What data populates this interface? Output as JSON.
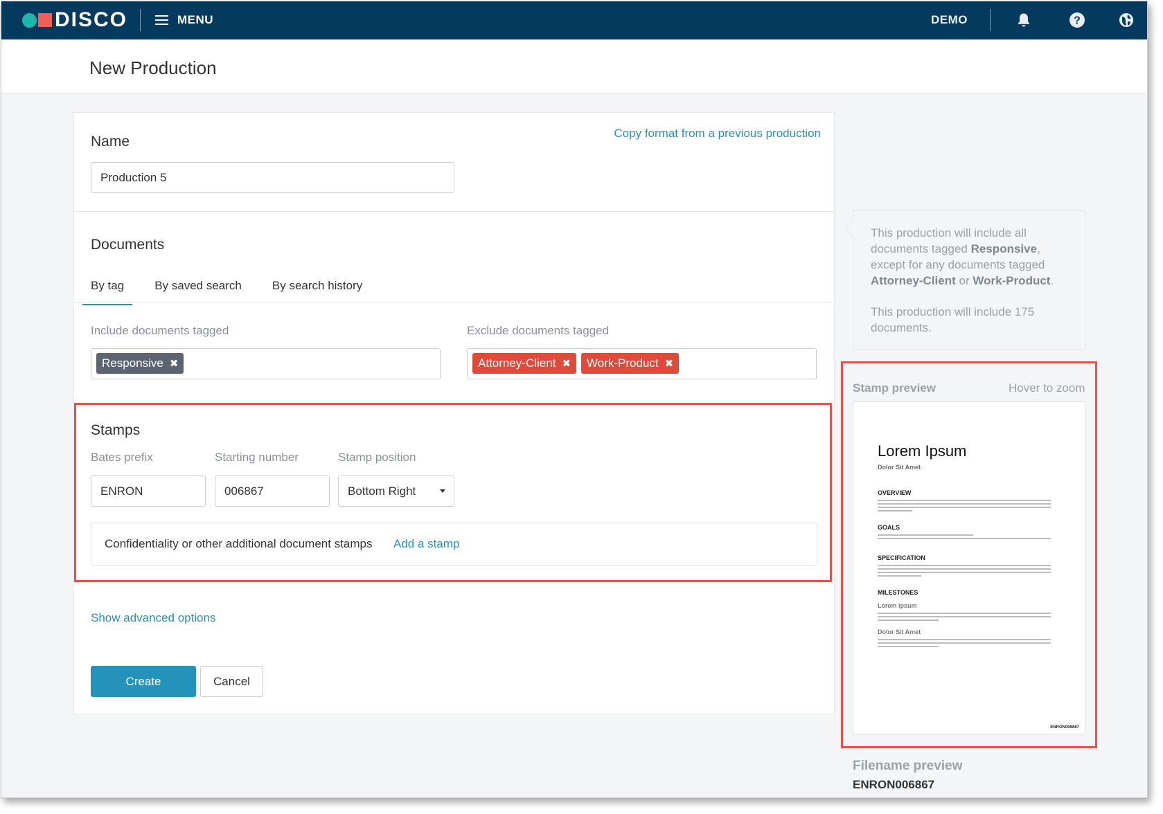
{
  "app": {
    "logo_text": "DISCO",
    "menu_label": "MENU",
    "user_label": "DEMO",
    "icons": [
      "bell-icon",
      "help-icon",
      "globe-icon",
      "hamburger-icon"
    ]
  },
  "page": {
    "title": "New Production"
  },
  "name_section": {
    "heading": "Name",
    "copy_link": "Copy format from a previous production",
    "name_value": "Production 5"
  },
  "documents": {
    "heading": "Documents",
    "tabs": [
      {
        "label": "By tag",
        "active": true
      },
      {
        "label": "By saved search",
        "active": false
      },
      {
        "label": "By search history",
        "active": false
      }
    ],
    "include_label": "Include documents tagged",
    "include_tags": [
      "Responsive"
    ],
    "exclude_label": "Exclude documents tagged",
    "exclude_tags": [
      "Attorney-Client",
      "Work-Product"
    ]
  },
  "stamps": {
    "heading": "Stamps",
    "bates_prefix_label": "Bates prefix",
    "bates_prefix_value": "ENRON",
    "starting_number_label": "Starting number",
    "starting_number_value": "006867",
    "position_label": "Stamp position",
    "position_value": "Bottom Right",
    "additional_text": "Confidentiality or other additional document stamps",
    "add_stamp_link": "Add a stamp"
  },
  "advanced_link": "Show advanced options",
  "actions": {
    "create": "Create",
    "cancel": "Cancel"
  },
  "summary": {
    "line1_a": "This production will include all documents tagged",
    "tag_include": "Responsive",
    "line1_b": ", except for any documents tagged",
    "tag_ex1": "Attorney-Client",
    "or_word": "or",
    "tag_ex2": "Work-Product",
    "line1_end": ".",
    "line2": "This production will include 175 documents."
  },
  "stamp_preview": {
    "label": "Stamp preview",
    "hint": "Hover to zoom",
    "doc_title": "Lorem Ipsum",
    "doc_subtitle": "Dolor Sit Amet",
    "h_overview": "OVERVIEW",
    "h_goals": "GOALS",
    "h_spec": "SPECIFICATION",
    "h_milestones": "MILESTONES",
    "sub_lorem": "Lorem ipsum",
    "sub_dolor": "Dolor Sit Amet",
    "stamp_text": "ENRON006867"
  },
  "filename_preview": {
    "label": "Filename preview",
    "value": "ENRON006867"
  },
  "colors": {
    "header": "#053a5f",
    "link": "#2493b9",
    "primary_button": "#2493b9",
    "exclude_tag": "#e04a3b",
    "include_tag": "#5b6470",
    "highlight": "#e8504a"
  }
}
